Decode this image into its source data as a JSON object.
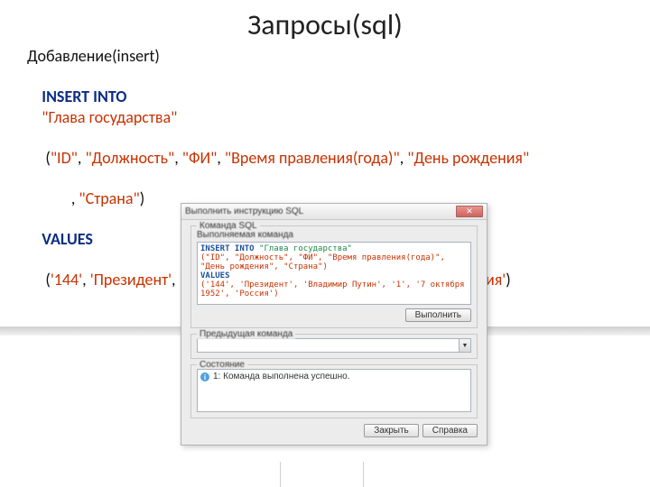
{
  "page": {
    "title": "Запросы(sql)",
    "subtitle": "Добавление(insert)"
  },
  "sql_example": {
    "kw_insert": "INSERT INTO",
    "table": "\"Глава государства\"",
    "cols_open": "(",
    "col1": "\"ID\"",
    "col2": "\"Должность\"",
    "col3": "\"ФИ\"",
    "col4": "\"Время правления(года)\"",
    "col5": "\"День рождения\"",
    "col6": "\"Страна\"",
    "cols_close": ")",
    "kw_values": "VALUES",
    "vals_open": "(",
    "v1": "'144'",
    "v2": "'Президент'",
    "v3": "'Владимир Путин'",
    "v4": "'1'",
    "v5": "'7 октября 1952'",
    "v6": "'Россия'",
    "vals_close": ")"
  },
  "dialog": {
    "title": "Выполнить инструкцию SQL",
    "close_glyph": "✕",
    "group1_legend": "Команда SQL",
    "group1_label": "Выполняемая команда",
    "textarea_kw1": "INSERT INTO",
    "textarea_name": " \"Глава государства\"",
    "textarea_line2": "(\"ID\", \"Должность\", \"ФИ\", \"Время правления(года)\", \"День рождения\", \"Страна\")",
    "textarea_kw2": "VALUES",
    "textarea_line4": "('144', 'Президент', 'Владимир Путин', '1', '7 октября 1952', 'Россия')",
    "execute_btn": "Выполнить",
    "group2_legend": "Предыдущая команда",
    "combo_value": "",
    "group3_legend": "Состояние",
    "status_text": "1: Команда выполнена успешно.",
    "close_btn": "Закрыть",
    "help_btn": "Справка"
  }
}
